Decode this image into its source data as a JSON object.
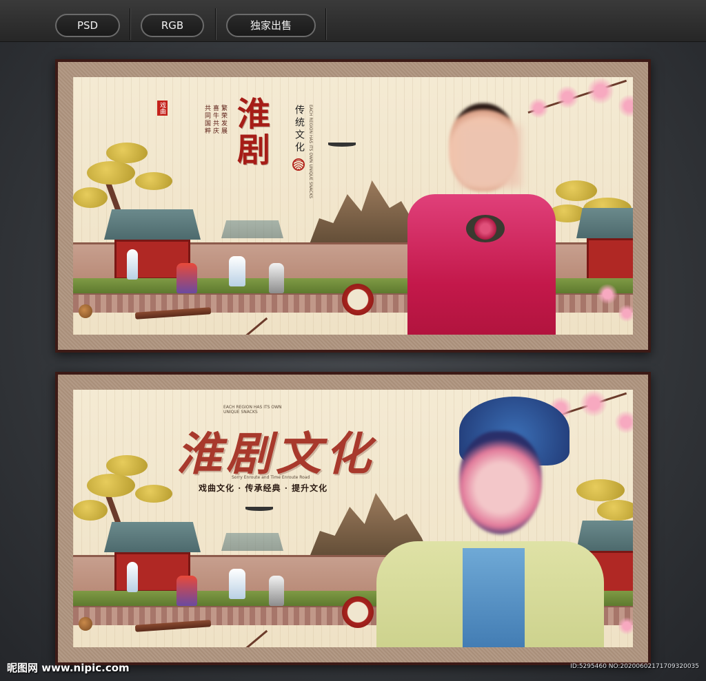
{
  "topbar": {
    "buttons": [
      {
        "label": "PSD"
      },
      {
        "label": "RGB"
      },
      {
        "label": "独家出售"
      }
    ]
  },
  "poster1": {
    "title": "淮剧",
    "tagline": "传统文化",
    "seal": "戏曲",
    "column1": "共同国粹",
    "column2": "喜牛共庆",
    "column3": "繁荣发展",
    "english": "EACH REGION HAS ITS OWN UNIQUE SNACKS"
  },
  "poster2": {
    "title": "淮剧文化",
    "english_top": "EACH REGION HAS ITS OWN UNIQUE SNACKS",
    "subtitle": "戏曲文化 · 传承经典 · 提升文化",
    "small_line": "Sorry Enroute and Time Enroute Road"
  },
  "footer": {
    "logo": "昵图网 www.nipic.com",
    "id_text": "ID:5295460 NO:20200602171709320035"
  },
  "colors": {
    "accent_red": "#a61d17",
    "frame": "#3c1a16",
    "paper": "#f4ead3"
  }
}
